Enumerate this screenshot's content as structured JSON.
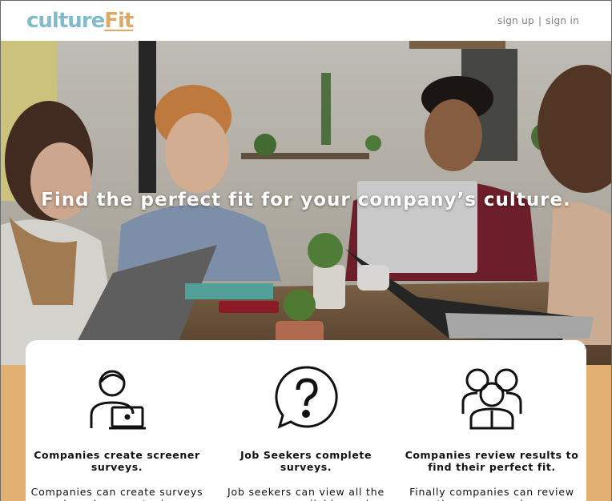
{
  "brand": {
    "part1": "culture",
    "part2": "Fit"
  },
  "nav": {
    "sign_up": "sign up",
    "separator": "|",
    "sign_in": "sign in"
  },
  "hero": {
    "title": "Find the perfect fit for your company’s culture."
  },
  "features": [
    {
      "icon": "person-laptop-icon",
      "title": "Companies create screener surveys.",
      "text": "Companies can create surveys based on any topic"
    },
    {
      "icon": "question-bubble-icon",
      "title": "Job Seekers complete surveys.",
      "text": "Job seekers can view all the surveys available, and"
    },
    {
      "icon": "group-people-icon",
      "title": "Companies review results to find their perfect fit.",
      "text": "Finally companies can review the scores, and see"
    }
  ],
  "colors": {
    "brand_teal": "#80bcc9",
    "brand_gold": "#dfa865",
    "panel": "#e2b073"
  }
}
